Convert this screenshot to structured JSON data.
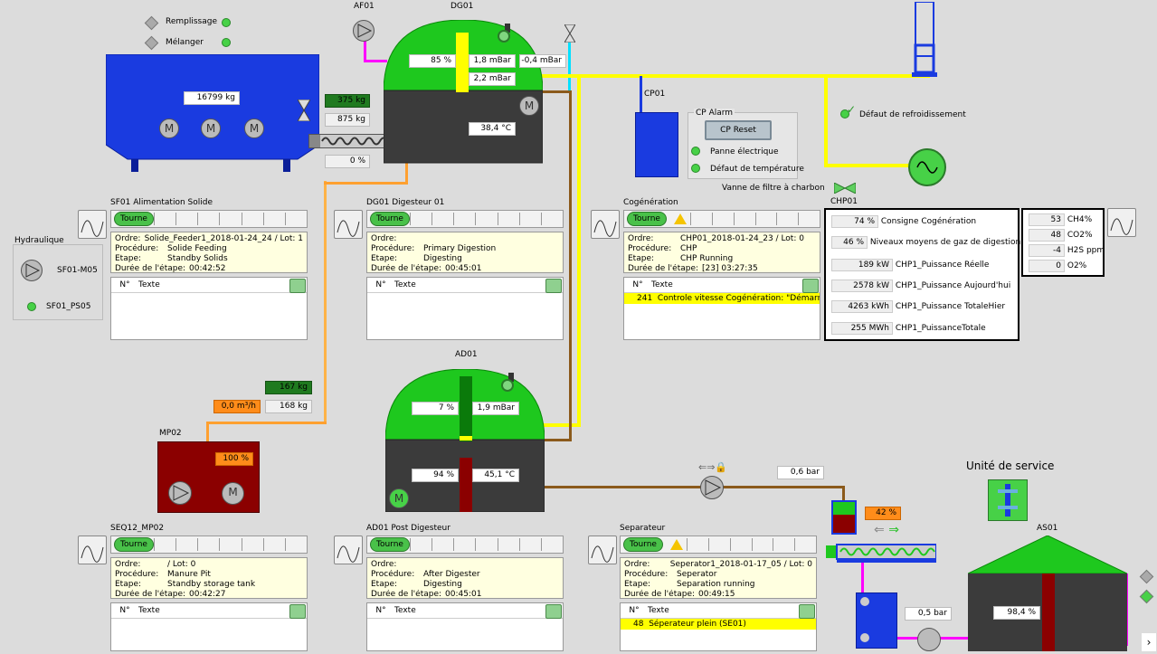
{
  "feeder": {
    "remplissage": "Remplissage",
    "melanger": "Mélanger",
    "weight": "16799 kg",
    "out1": "375 kg",
    "out2": "875 kg",
    "pct": "0 %"
  },
  "af01": "AF01",
  "dg01": {
    "title": "DG01",
    "level": "85 %",
    "p1": "1,8 mBar",
    "p2": "2,2 mBar",
    "p3": "-0,4 mBar",
    "temp": "38,4 °C"
  },
  "cp01": {
    "title": "CP01",
    "alarm_title": "CP Alarm",
    "reset": "CP Reset",
    "a1": "Panne électrique",
    "a2": "Défaut de température",
    "vanne": "Vanne de filtre à charbon"
  },
  "cooling": "Défaut de refroidissement",
  "chp01": {
    "title": "CHP01",
    "rows": [
      {
        "v": "74 %",
        "l": "Consigne Cogénération"
      },
      {
        "v": "46 %",
        "l": "Niveaux moyens de gaz de digestion"
      },
      {
        "v": "189 kW",
        "l": "CHP1_Puissance Réelle"
      },
      {
        "v": "2578 kW",
        "l": "CHP1_Puissance Aujourd'hui"
      },
      {
        "v": "4263 kWh",
        "l": "CHP1_Puissance TotaleHier"
      },
      {
        "v": "255 MWh",
        "l": "CHP1_PuissanceTotale"
      }
    ],
    "gas": [
      {
        "v": "53",
        "l": "CH4%"
      },
      {
        "v": "48",
        "l": "CO2%"
      },
      {
        "v": "-4",
        "l": "H2S ppm"
      },
      {
        "v": "0",
        "l": "O2%"
      }
    ]
  },
  "hydraulique": {
    "title": "Hydraulique",
    "m": "SF01-M05",
    "ps": "SF01_PS05"
  },
  "panels": {
    "sf01": {
      "title": "SF01 Alimentation Solide",
      "state": "Tourne",
      "ordre": "Solide_Feeder1_2018-01-24_24 / Lot: 1",
      "proc": "Solide Feeding",
      "etape": "Standby Solids",
      "duree": "00:42:52"
    },
    "dg01": {
      "title": "DG01 Digesteur 01",
      "state": "Tourne",
      "ordre": "",
      "proc": "Primary Digestion",
      "etape": "Digesting",
      "duree": "00:45:01"
    },
    "cog": {
      "title": "Cogénération",
      "state": "Tourne",
      "ordre": "CHP01_2018-01-24_23 / Lot: 0",
      "proc": "CHP",
      "etape": "CHP Running",
      "duree": "[23] 03:27:35",
      "row_n": "241",
      "row_t": "Controle vitesse Cogénération: \"Démarre a"
    },
    "seq12": {
      "title": "SEQ12_MP02",
      "state": "Tourne",
      "ordre": "/ Lot: 0",
      "proc": "Manure Pit",
      "etape": "Standby storage tank",
      "duree": "00:42:27"
    },
    "ad01": {
      "title": "AD01 Post Digesteur",
      "state": "Tourne",
      "ordre": "",
      "proc": "After Digester",
      "etape": "Digesting",
      "duree": "00:45:01"
    },
    "sep": {
      "title": "Separateur",
      "state": "Tourne",
      "ordre": "Seperator1_2018-01-17_05 / Lot: 0",
      "proc": "Seperator",
      "etape": "Separation running",
      "duree": "00:49:15",
      "row_n": "48",
      "row_t": "Séperateur plein (SE01)"
    }
  },
  "labels": {
    "ordre": "Ordre:",
    "proc": "Procédure:",
    "etape": "Étape:",
    "duree": "Durée de l'étape:",
    "n": "N°",
    "texte": "Texte"
  },
  "mp02": {
    "title": "MP02",
    "flow": "0,0 m³/h",
    "w1": "167 kg",
    "w2": "168 kg",
    "pct": "100 %"
  },
  "ad01": {
    "title": "AD01",
    "level": "7 %",
    "p": "1,9 mBar",
    "l2": "94 %",
    "temp": "45,1 °C"
  },
  "separator": {
    "pressure": "0,6 bar",
    "pct": "42 %",
    "p2": "0,5 bar"
  },
  "service": "Unité de service",
  "as01": {
    "title": "AS01",
    "level": "98,4 %"
  }
}
